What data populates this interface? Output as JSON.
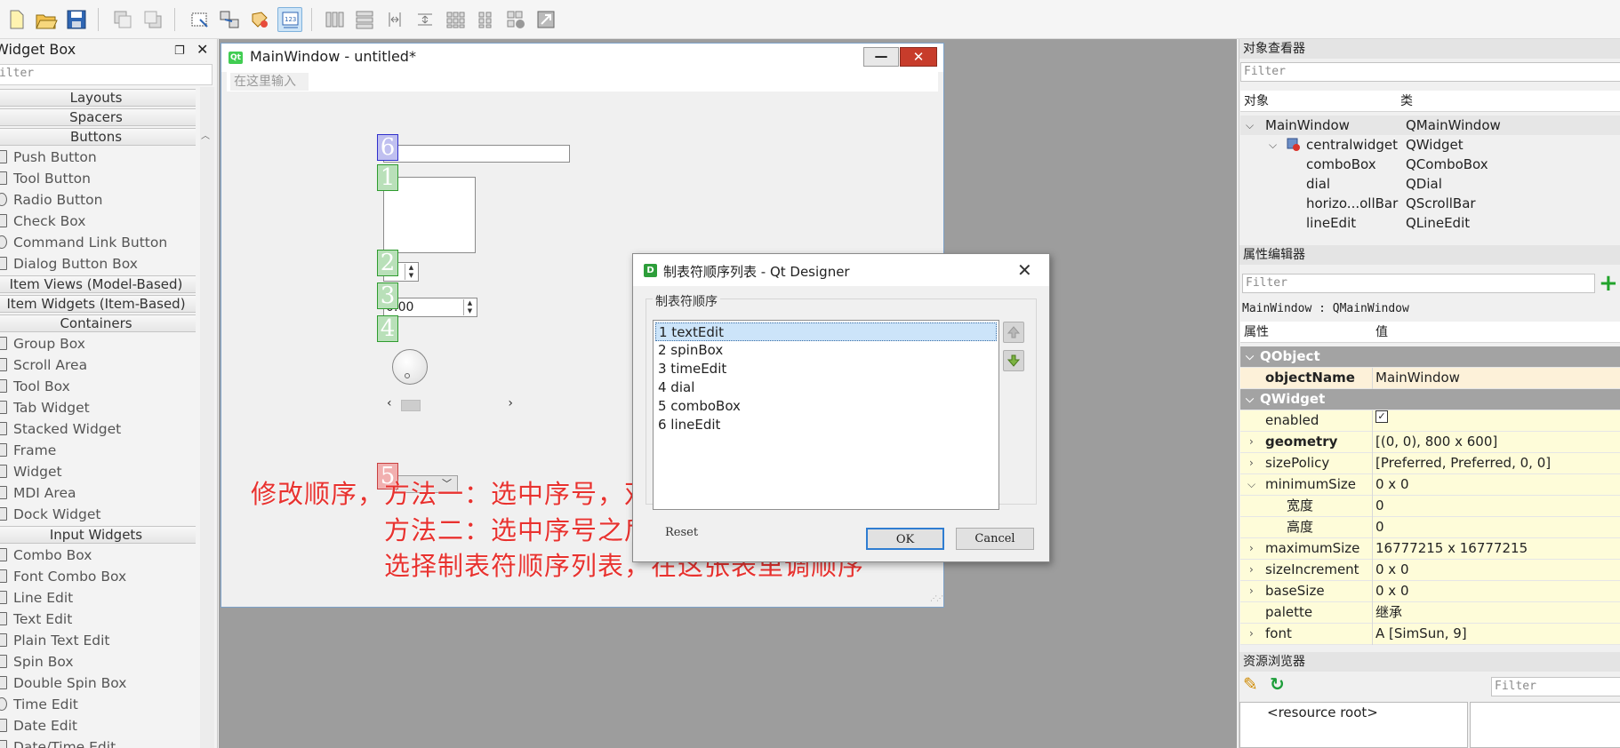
{
  "toolbar": {
    "icons": [
      "new-file-icon",
      "open-folder-icon",
      "save-icon",
      "raise-icon",
      "lower-icon",
      "edit-widgets-icon",
      "edit-signals-icon",
      "edit-buddies-icon",
      "edit-tab-order-icon",
      "layout-horizontal-icon",
      "layout-vertical-icon",
      "splitter-horizontal-icon",
      "splitter-vertical-icon",
      "layout-grid-icon",
      "layout-form-icon",
      "break-layout-icon",
      "adjust-size-icon"
    ]
  },
  "widget_box": {
    "title": "Widget Box",
    "filter_placeholder": "ilter",
    "categories": {
      "layouts": "Layouts",
      "spacers": "Spacers",
      "buttons": "Buttons",
      "item_views": "Item Views (Model-Based)",
      "item_widgets": "Item Widgets (Item-Based)",
      "containers": "Containers",
      "input_widgets": "Input Widgets"
    },
    "buttons": [
      "Push Button",
      "Tool Button",
      "Radio Button",
      "Check Box",
      "Command Link Button",
      "Dialog Button Box"
    ],
    "containers": [
      "Group Box",
      "Scroll Area",
      "Tool Box",
      "Tab Widget",
      "Stacked Widget",
      "Frame",
      "Widget",
      "MDI Area",
      "Dock Widget"
    ],
    "inputs": [
      "Combo Box",
      "Font Combo Box",
      "Line Edit",
      "Text Edit",
      "Plain Text Edit",
      "Spin Box",
      "Double Spin Box",
      "Time Edit",
      "Date Edit",
      "Date/Time Edit"
    ]
  },
  "main_window": {
    "title": "MainWindow - untitled*",
    "logo": "Qt",
    "menu_hint": "在这里输入",
    "badges": [
      "6",
      "1",
      "2",
      "3",
      "4",
      "5"
    ],
    "spin_value": "0",
    "time_value": "0:00"
  },
  "annotation": {
    "line1": "修改顺序，方法一：选中序号，双击右键",
    "line2": "方法二：选中序号之后，单击右键，",
    "line3": "选择制表符顺序列表，在这张表里调顺序"
  },
  "dialog": {
    "logo": "D",
    "title": "制表符顺序列表 - Qt Designer",
    "group_label": "制表符顺序",
    "items": [
      "1 textEdit",
      "2 spinBox",
      "3 timeEdit",
      "4 dial",
      "5 comboBox",
      "6 lineEdit"
    ],
    "reset": "Reset",
    "ok": "OK",
    "cancel": "Cancel"
  },
  "object_inspector": {
    "title": "对象查看器",
    "filter_placeholder": "Filter",
    "col_object": "对象",
    "col_class": "类",
    "rows": [
      {
        "name": "MainWindow",
        "cls": "QMainWindow"
      },
      {
        "name": "centralwidget",
        "cls": "QWidget"
      },
      {
        "name": "comboBox",
        "cls": "QComboBox"
      },
      {
        "name": "dial",
        "cls": "QDial"
      },
      {
        "name": "horizo...ollBar",
        "cls": "QScrollBar"
      },
      {
        "name": "lineEdit",
        "cls": "QLineEdit"
      }
    ]
  },
  "property_editor": {
    "title": "属性编辑器",
    "filter_placeholder": "Filter",
    "context": "MainWindow : QMainWindow",
    "col_property": "属性",
    "col_value": "值",
    "sections": [
      "QObject",
      "QWidget"
    ],
    "props": {
      "objectName": {
        "name": "objectName",
        "value": "MainWindow"
      },
      "enabled": {
        "name": "enabled",
        "value": "✓"
      },
      "geometry": {
        "name": "geometry",
        "value": "[(0, 0), 800 x 600]"
      },
      "sizePolicy": {
        "name": "sizePolicy",
        "value": "[Preferred, Preferred, 0, 0]"
      },
      "minimumSize": {
        "name": "minimumSize",
        "value": "0 x 0"
      },
      "width": {
        "name": "宽度",
        "value": "0"
      },
      "height": {
        "name": "高度",
        "value": "0"
      },
      "maximumSize": {
        "name": "maximumSize",
        "value": "16777215 x 16777215"
      },
      "sizeIncrement": {
        "name": "sizeIncrement",
        "value": "0 x 0"
      },
      "baseSize": {
        "name": "baseSize",
        "value": "0 x 0"
      },
      "palette": {
        "name": "palette",
        "value": "继承"
      },
      "font": {
        "name": "font",
        "value": "A  [SimSun, 9]"
      }
    }
  },
  "resource_browser": {
    "title": "资源浏览器",
    "filter_placeholder": "Filter",
    "root": "<resource root>"
  },
  "colors": {
    "accent": "#2f7dd1",
    "annotation": "#e8322f",
    "section_header": "#a3a3a3",
    "badge_green": "#2f9c2f"
  }
}
